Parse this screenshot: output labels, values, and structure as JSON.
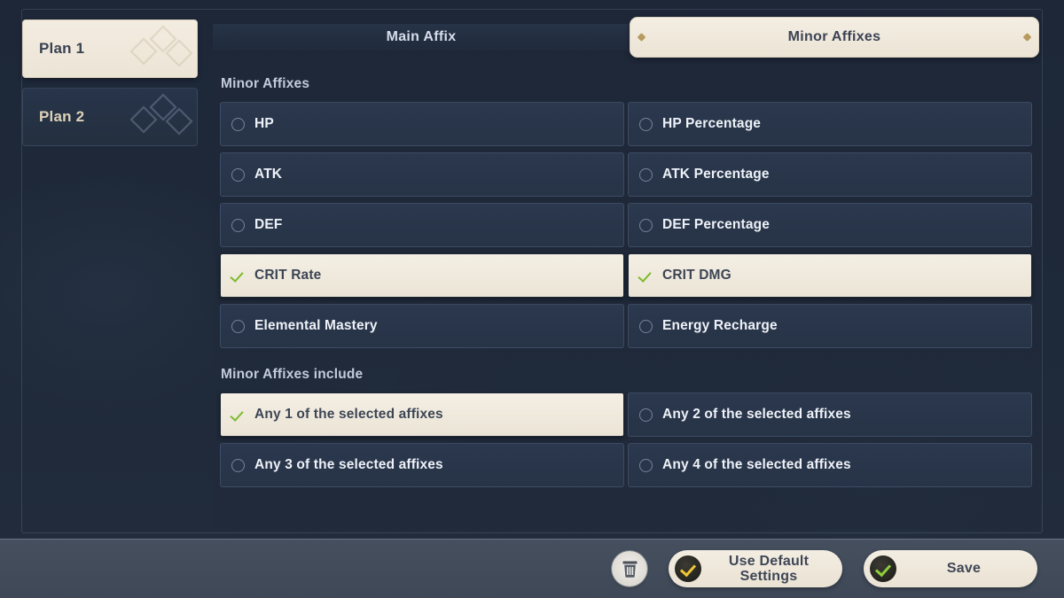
{
  "plans": [
    {
      "label": "Plan 1",
      "active": true
    },
    {
      "label": "Plan 2",
      "active": false
    }
  ],
  "tabs": [
    {
      "label": "Main Affix",
      "active": false
    },
    {
      "label": "Minor Affixes",
      "active": true
    }
  ],
  "sections": {
    "affixes": {
      "title": "Minor Affixes",
      "options": [
        {
          "label": "HP",
          "selected": false
        },
        {
          "label": "HP Percentage",
          "selected": false
        },
        {
          "label": "ATK",
          "selected": false
        },
        {
          "label": "ATK Percentage",
          "selected": false
        },
        {
          "label": "DEF",
          "selected": false
        },
        {
          "label": "DEF Percentage",
          "selected": false
        },
        {
          "label": "CRIT Rate",
          "selected": true
        },
        {
          "label": "CRIT DMG",
          "selected": true
        },
        {
          "label": "Elemental Mastery",
          "selected": false
        },
        {
          "label": "Energy Recharge",
          "selected": false
        }
      ]
    },
    "include": {
      "title": "Minor Affixes include",
      "options": [
        {
          "label": "Any 1 of the selected affixes",
          "selected": true
        },
        {
          "label": "Any 2 of the selected affixes",
          "selected": false
        },
        {
          "label": "Any 3 of the selected affixes",
          "selected": false
        },
        {
          "label": "Any 4 of the selected affixes",
          "selected": false
        }
      ]
    }
  },
  "footer": {
    "delete_icon": "trash-icon",
    "default_button": {
      "label": "Use Default\nSettings",
      "line1": "Use Default",
      "line2": "Settings",
      "check_color": "#f0c535"
    },
    "save_button": {
      "label": "Save",
      "check_color": "#8fce3a"
    }
  },
  "colors": {
    "background": "#1e2939",
    "panel": "#202a3a",
    "selected_bg": "#efe8da",
    "selected_text": "#3d4554",
    "unselected_bg": "#2b384e",
    "unselected_text": "#eef2f8",
    "check_green": "#7cbb2c",
    "tab_active_bg": "#f0e9dd",
    "ornament_gold": "#b79a5e",
    "bottom_bar": "#454f5e"
  }
}
